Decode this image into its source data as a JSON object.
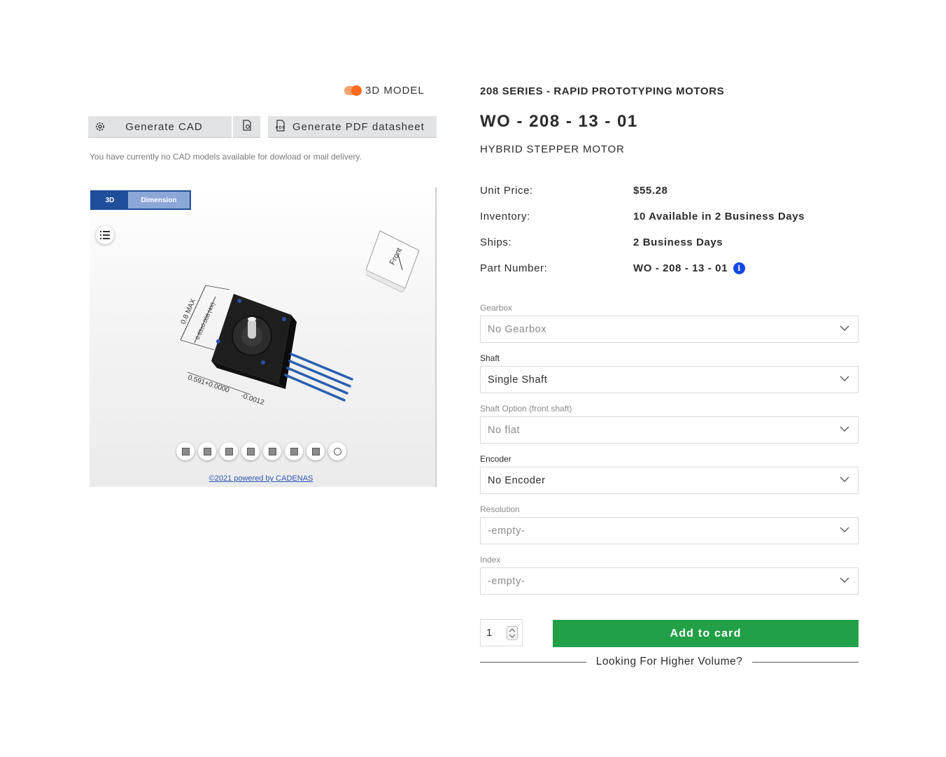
{
  "model_toggle": {
    "label": "3D MODEL",
    "on": true
  },
  "cad": {
    "generate_cad_label": "Generate CAD",
    "generate_pdf_label": "Generate PDF datasheet",
    "note": "You have currently no CAD models available for dowload or mail delivery."
  },
  "viewer": {
    "tabs": [
      "3D",
      "Dimension"
    ],
    "cube_label": "Front",
    "dimensions": {
      "height": "0.8 MAX",
      "width": "0.63±0.008 (4X)",
      "shaft": "0.591+0.0000",
      "shaft_tol": "-0.0012"
    },
    "footer": "©2021 powered by CADENAS"
  },
  "product": {
    "series": "208 SERIES - RAPID PROTOTYPING MOTORS",
    "title": "WO - 208 - 13 - 01",
    "subtitle": "HYBRID STEPPER MOTOR",
    "specs": [
      {
        "label": "Unit Price:",
        "value": "$55.28"
      },
      {
        "label": "Inventory:",
        "value": "10 Available in 2 Business Days"
      },
      {
        "label": "Ships:",
        "value": "2 Business Days"
      },
      {
        "label": "Part Number:",
        "value": "WO - 208 - 13 - 01"
      }
    ]
  },
  "options": [
    {
      "label": "Gearbox",
      "value": "No Gearbox",
      "enabled": false
    },
    {
      "label": "Shaft",
      "value": "Single Shaft",
      "enabled": true
    },
    {
      "label": "Shaft Option (front shaft)",
      "value": "No flat",
      "enabled": false
    },
    {
      "label": "Encoder",
      "value": "No Encoder",
      "enabled": true
    },
    {
      "label": "Resolution",
      "value": "-empty-",
      "enabled": false
    },
    {
      "label": "Index",
      "value": "-empty-",
      "enabled": false
    }
  ],
  "cart": {
    "quantity": "1",
    "add_label": "Add to card",
    "volume_text": "Looking For Higher Volume?"
  },
  "colors": {
    "accent_orange": "#ff6a1a",
    "add_green": "#22a047",
    "info_blue": "#1447e6",
    "viewer_tab_blue": "#1f4e9c"
  }
}
